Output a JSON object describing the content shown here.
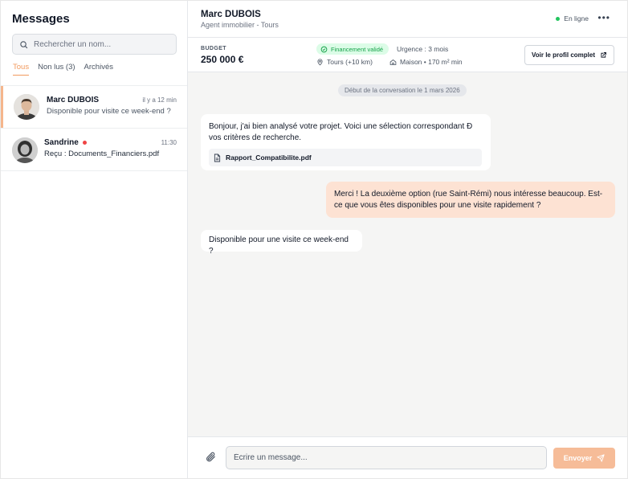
{
  "sidebar": {
    "title": "Messages",
    "search": {
      "placeholder": "Rechercher un nom..."
    },
    "filters": [
      {
        "label": "Tous",
        "active": true
      },
      {
        "label": "Non lus (3)",
        "active": false
      },
      {
        "label": "Archivés",
        "active": false
      }
    ],
    "conversations": [
      {
        "name": "Marc DUBOIS",
        "time": "il y a 12 min",
        "preview": "Disponible pour visite ce week-end ?",
        "active": true,
        "unread": false
      },
      {
        "name": "Sandrine",
        "time": "11:30",
        "preview": "Reçu : Documents_Financiers.pdf",
        "active": false,
        "unread": true
      }
    ]
  },
  "header": {
    "name": "Marc DUBOIS",
    "subtitle": "Agent immobilier - Tours",
    "status": "En ligne",
    "more_icon": "more-horizontal-icon"
  },
  "infobar": {
    "budget_label": "BUDGET",
    "budget_value": "250 000 €",
    "financing_badge": "Financement validé",
    "urgency": "Urgence : 3 mois",
    "location": "Tours (+10 km)",
    "property": "Maison • 170 m² min",
    "profile_button": "Voir le profil complet"
  },
  "chat": {
    "date_divider": "Début de la conversation le 1 mars 2026",
    "messages": [
      {
        "direction": "in",
        "text": "Bonjour, j'ai bien analysé votre projet. Voici une sélection correspondant Ð vos critères de recherche.",
        "attachment": "Rapport_Compatibilite.pdf"
      },
      {
        "direction": "out",
        "text": "Merci ! La deuxième option (rue Saint-Rémi) nous intéresse beaucoup. Est-ce que vous êtes disponibles pour une visite rapidement ?"
      },
      {
        "direction": "in",
        "text": "Disponible pour une visite ce week-end ?"
      }
    ]
  },
  "composer": {
    "placeholder": "Écrire un message...",
    "send_label": "Envoyer"
  },
  "colors": {
    "accent": "#f29a5e",
    "outgoing_bubble": "#fde2d3",
    "send_button": "#f6bc98",
    "online": "#22c55e",
    "unread": "#ef4444",
    "badge_bg": "#dcfce7",
    "badge_text": "#16a34a"
  }
}
